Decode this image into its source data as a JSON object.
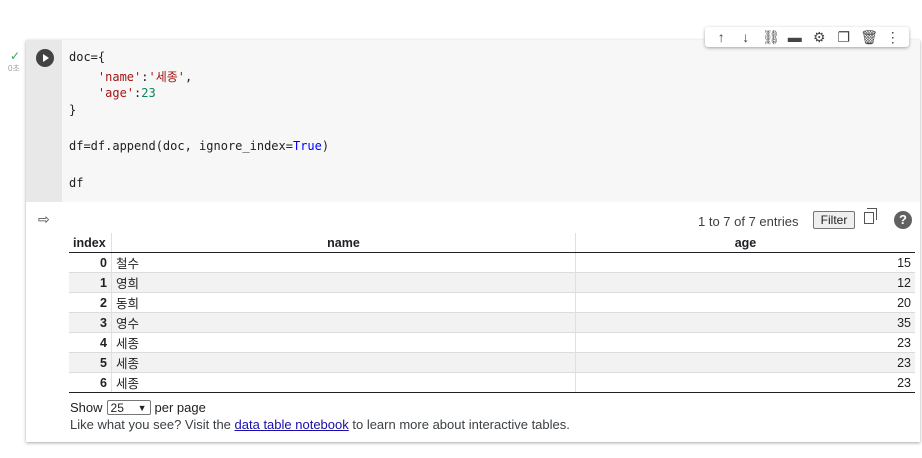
{
  "previous_output": {
    "index": "3",
    "name": "영수",
    "age": "35"
  },
  "cell": {
    "exec_time": "0초",
    "code": {
      "l1": "doc={",
      "l2_key": "'name'",
      "l2_sep": ":",
      "l2_val": "'세종'",
      "l2_end": ",",
      "l3_key": "'age'",
      "l3_sep": ":",
      "l3_val": "23",
      "l4": "}",
      "l5_a": "df=df.append(doc, ignore_index=",
      "l5_kw": "True",
      "l5_b": ")",
      "l6": "df"
    }
  },
  "toolbar": {
    "icons": [
      "arrow-up-icon",
      "arrow-down-icon",
      "link-icon",
      "comment-icon",
      "settings-icon",
      "mirror-cell-icon",
      "delete-icon",
      "more-icon"
    ],
    "glyphs": [
      "↑",
      "↓",
      "⛓",
      "▬",
      "⚙",
      "❐",
      "🗑",
      "⋮"
    ]
  },
  "output": {
    "entries_text": "1 to 7 of 7 entries",
    "filter_label": "Filter",
    "help_label": "?",
    "table": {
      "columns": [
        "index",
        "name",
        "age"
      ],
      "rows": [
        {
          "index": "0",
          "name": "철수",
          "age": "15"
        },
        {
          "index": "1",
          "name": "영희",
          "age": "12"
        },
        {
          "index": "2",
          "name": "동희",
          "age": "20"
        },
        {
          "index": "3",
          "name": "영수",
          "age": "35"
        },
        {
          "index": "4",
          "name": "세종",
          "age": "23"
        },
        {
          "index": "5",
          "name": "세종",
          "age": "23"
        },
        {
          "index": "6",
          "name": "세종",
          "age": "23"
        }
      ]
    },
    "show_label": "Show",
    "page_size": "25",
    "per_page_label": "per page",
    "footer_prefix": "Like what you see? Visit the ",
    "footer_link": "data table notebook",
    "footer_suffix": " to learn more about interactive tables."
  }
}
